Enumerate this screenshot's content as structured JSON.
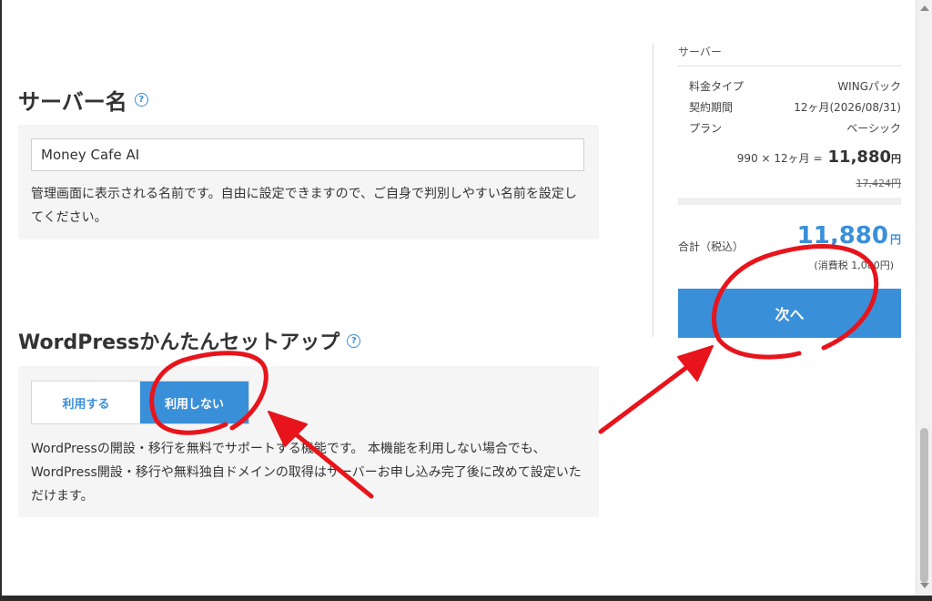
{
  "server_name": {
    "title": "サーバー名",
    "help_glyph": "?",
    "input_value": "Money Cafe AI",
    "help_text": "管理画面に表示される名前です。自由に設定できますので、ご自身で判別しやすい名前を設定してください。"
  },
  "wordpress_setup": {
    "title": "WordPressかんたんセットアップ",
    "help_glyph": "?",
    "options": [
      "利用する",
      "利用しない"
    ],
    "selected": "利用しない",
    "help_text": "WordPressの開設・移行を無料でサポートする機能です。 本機能を利用しない場合でも、WordPress開設・移行や無料独自ドメインの取得はサーバーお申し込み完了後に改めて設定いただけます。"
  },
  "summary": {
    "heading": "サーバー",
    "rows": [
      {
        "label": "料金タイプ",
        "value": "WINGパック"
      },
      {
        "label": "契約期間",
        "value": "12ヶ月(2026/08/31)"
      },
      {
        "label": "プラン",
        "value": "ベーシック"
      }
    ],
    "calc_text": "990 × 12ヶ月 =",
    "calc_price": "11,880",
    "yen": "円",
    "original_price": "17,424円",
    "total_label": "合計（税込）",
    "total_amount": "11,880",
    "tax_text": "(消費税 1,080円)",
    "next_label": "次へ"
  },
  "colors": {
    "accent": "#3a8fd9",
    "annotation": "#e8141c",
    "panel_bg": "#f5f5f5"
  }
}
